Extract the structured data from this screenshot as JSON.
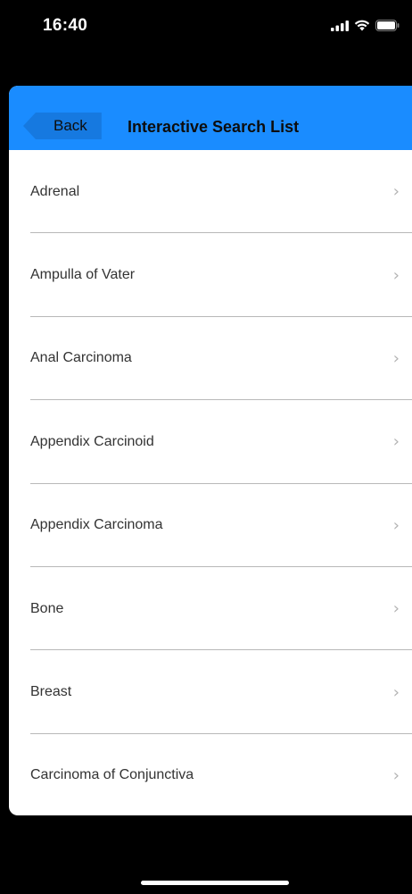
{
  "status_bar": {
    "time": "16:40"
  },
  "nav": {
    "back_label": "Back",
    "title": "Interactive Search List"
  },
  "list": {
    "items": [
      {
        "label": "Adrenal",
        "chevron": "›"
      },
      {
        "label": "Ampulla of Vater",
        "chevron": "›"
      },
      {
        "label": "Anal Carcinoma",
        "chevron": "›"
      },
      {
        "label": "Appendix Carcinoid",
        "chevron": "›"
      },
      {
        "label": "Appendix Carcinoma",
        "chevron": "›"
      },
      {
        "label": "Bone",
        "chevron": "›"
      },
      {
        "label": "Breast",
        "chevron": "›"
      },
      {
        "label": "Carcinoma of Conjunctiva",
        "chevron": "›"
      }
    ]
  },
  "colors": {
    "nav_background": "#1a8cff",
    "back_button_background": "#1679e0",
    "screen_background": "#000000",
    "sheet_background": "#ffffff",
    "separator": "#b8b8b8",
    "chevron": "#b3b3b3"
  },
  "icons": {
    "signal": "signal-icon",
    "wifi": "wifi-icon",
    "battery": "battery-icon",
    "disclosure": "chevron-right-icon"
  }
}
